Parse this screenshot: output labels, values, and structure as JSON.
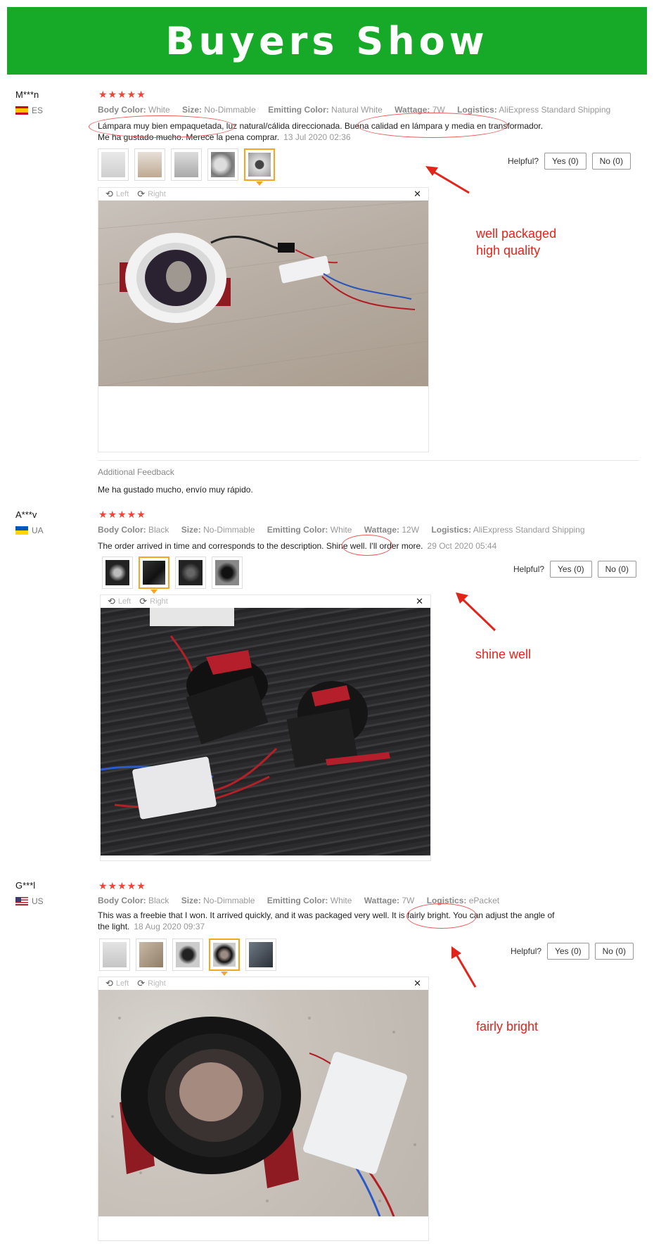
{
  "banner": {
    "title": "Buyers Show"
  },
  "labels": {
    "body_color": "Body Color:",
    "size": "Size:",
    "emitting_color": "Emitting Color:",
    "wattage": "Wattage:",
    "logistics": "Logistics:",
    "helpful": "Helpful?",
    "viewer_left": "Left",
    "viewer_right": "Right",
    "additional_feedback": "Additional Feedback"
  },
  "reviews": [
    {
      "name": "M***n",
      "country": "ES",
      "stars": "★★★★★",
      "body_color": "White",
      "size": "No-Dimmable",
      "emitting_color": "Natural White",
      "wattage": "7W",
      "logistics": "AliExpress Standard Shipping",
      "comment": "Lámpara muy bien empaquetada, luz natural/cálida direccionada. Buena calidad en lámpara y media en transformador. Me ha gustado mucho. Merece la pena comprar.",
      "date": "13 Jul 2020 02:36",
      "yes": "Yes (0)",
      "no": "No (0)",
      "note": "well packaged\nhigh quality",
      "additional": "Me ha gustado mucho, envío muy rápido."
    },
    {
      "name": "A***v",
      "country": "UA",
      "stars": "★★★★★",
      "body_color": "Black",
      "size": "No-Dimmable",
      "emitting_color": "White",
      "wattage": "12W",
      "logistics": "AliExpress Standard Shipping",
      "comment": "The order arrived in time and corresponds to the description. Shine well. I'll order more.",
      "date": "29 Oct 2020 05:44",
      "yes": "Yes (0)",
      "no": "No (0)",
      "note": "shine well"
    },
    {
      "name": "G***l",
      "country": "US",
      "stars": "★★★★★",
      "body_color": "Black",
      "size": "No-Dimmable",
      "emitting_color": "White",
      "wattage": "7W",
      "logistics": "ePacket",
      "comment": "This was a freebie that I won. It arrived quickly, and it was packaged very well. It is fairly bright. You can adjust the angle of the light.",
      "date": "18 Aug 2020 09:37",
      "yes": "Yes (0)",
      "no": "No (0)",
      "note": "fairly bright"
    }
  ],
  "colors": {
    "banner": "#17aa28",
    "stars": "#f44336",
    "annotation": "#e3241b",
    "active_thumb": "#f5a623"
  },
  "icons": [
    "rotate-left-icon",
    "rotate-right-icon",
    "close-icon",
    "arrow-pointer-icon"
  ]
}
